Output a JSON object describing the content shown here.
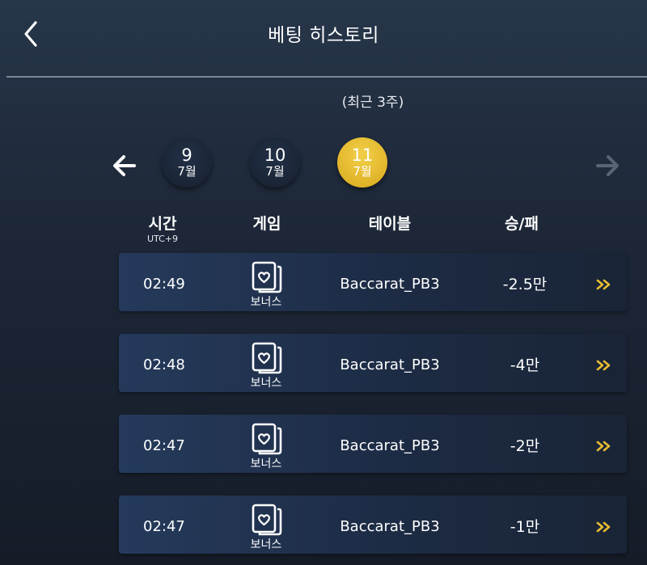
{
  "header": {
    "title": "베팅 히스토리"
  },
  "subtitle": "(최근 3주)",
  "dates": [
    {
      "day": "9",
      "month": "7월",
      "active": false
    },
    {
      "day": "10",
      "month": "7월",
      "active": false
    },
    {
      "day": "11",
      "month": "7월",
      "active": true
    }
  ],
  "columns": {
    "time": "시간",
    "timezone": "UTC+9",
    "game": "게임",
    "table": "테이블",
    "result": "승/패"
  },
  "rows": [
    {
      "time": "02:49",
      "game": "보너스",
      "table": "Baccarat_PB3",
      "result": "-2.5만"
    },
    {
      "time": "02:48",
      "game": "보너스",
      "table": "Baccarat_PB3",
      "result": "-4만"
    },
    {
      "time": "02:47",
      "game": "보너스",
      "table": "Baccarat_PB3",
      "result": "-2만"
    },
    {
      "time": "02:47",
      "game": "보너스",
      "table": "Baccarat_PB3",
      "result": "-1만"
    }
  ],
  "colors": {
    "accent": "#e9bd32",
    "disabled_arrow": "#5a6472"
  },
  "icons": {
    "back": "chevron-left-icon",
    "prev": "arrow-left-icon",
    "next": "arrow-right-icon",
    "game": "card-heart-icon",
    "detail": "double-chevron-right-icon"
  }
}
